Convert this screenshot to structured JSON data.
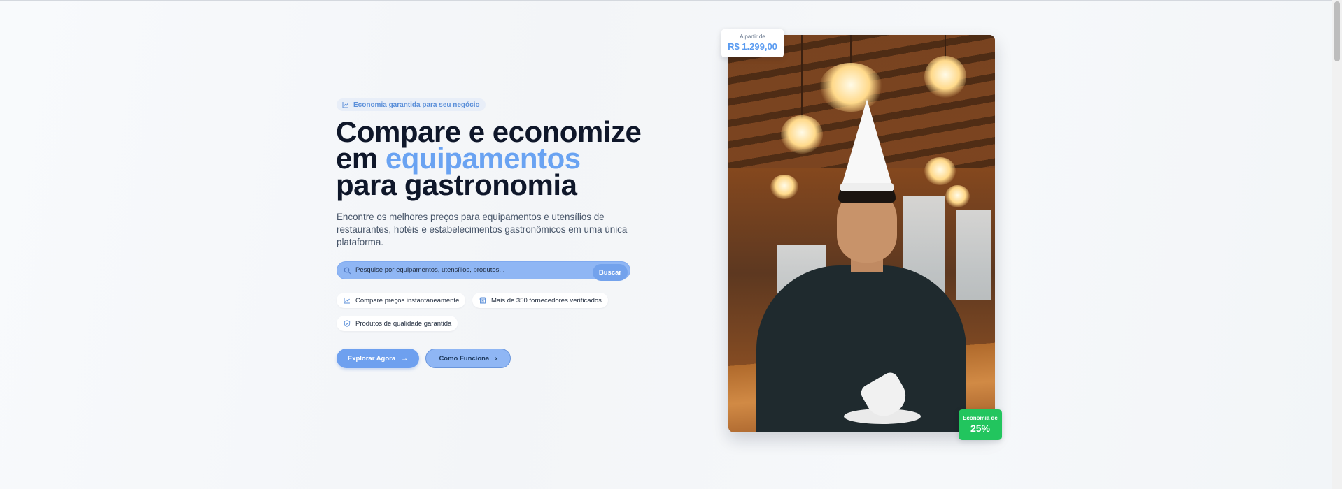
{
  "hero": {
    "badge": "Economia garantida para seu negócio",
    "headline_line1": "Compare e economize",
    "headline_em": "em",
    "headline_accent": "equipamentos",
    "headline_line3": "para gastronomia",
    "subtitle": "Encontre os melhores preços para equipamentos e utensílios de restaurantes, hotéis e estabelecimentos gastronômicos em uma única plataforma."
  },
  "search": {
    "placeholder": "Pesquise por equipamentos, utensílios, produtos...",
    "button": "Buscar"
  },
  "features": [
    {
      "label": "Compare preços instantaneamente",
      "icon": "chart-icon"
    },
    {
      "label": "Mais de 350 fornecedores verificados",
      "icon": "store-icon"
    },
    {
      "label": "Produtos de qualidade garantida",
      "icon": "shield-check-icon"
    }
  ],
  "cta": {
    "primary": "Explorar Agora",
    "secondary": "Como Funciona"
  },
  "price_card": {
    "label": "A partir de",
    "value": "R$ 1.299,00"
  },
  "saving_card": {
    "label": "Economia de",
    "value": "25%"
  },
  "colors": {
    "accent": "#6aa3f2",
    "success": "#22c55e",
    "text": "#0f172a"
  }
}
